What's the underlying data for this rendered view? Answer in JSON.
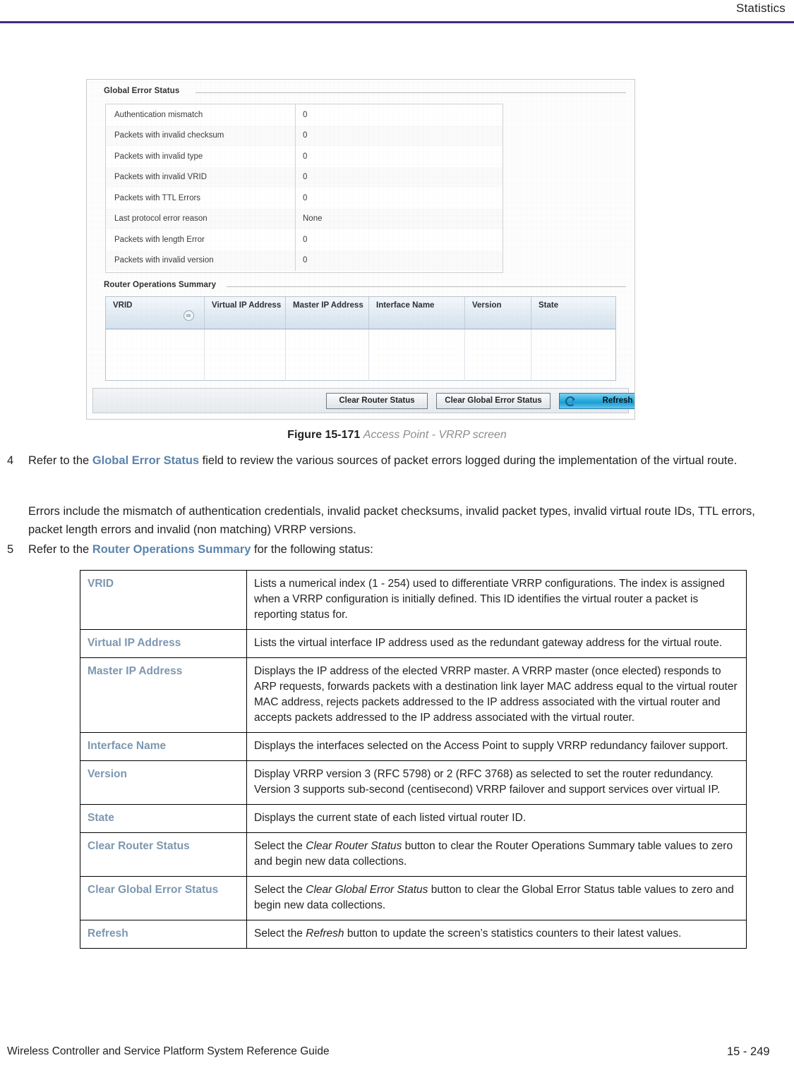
{
  "header": {
    "title": "Statistics"
  },
  "figure": {
    "number": "Figure 15-171",
    "label": "Access Point - VRRP screen",
    "screen": {
      "global_error_status": {
        "group_title": "Global Error Status",
        "rows": [
          {
            "label": "Authentication mismatch",
            "value": "0"
          },
          {
            "label": "Packets with invalid checksum",
            "value": "0"
          },
          {
            "label": "Packets with invalid type",
            "value": "0"
          },
          {
            "label": "Packets with invalid VRID",
            "value": "0"
          },
          {
            "label": "Packets with TTL Errors",
            "value": "0"
          },
          {
            "label": "Last protocol error reason",
            "value": "None"
          },
          {
            "label": "Packets with length Error",
            "value": "0"
          },
          {
            "label": "Packets with invalid version",
            "value": "0"
          }
        ]
      },
      "router_operations_summary": {
        "group_title": "Router Operations Summary",
        "columns": [
          "VRID",
          "Virtual IP Address",
          "Master IP Address",
          "Interface Name",
          "Version",
          "State"
        ],
        "rows": []
      },
      "buttons": {
        "clear_router_status": "Clear Router Status",
        "clear_global_error_status": "Clear Global Error Status",
        "refresh": "Refresh"
      }
    }
  },
  "steps": [
    {
      "num": "4",
      "lead": "Refer to the ",
      "emphasis": "Global Error Status",
      "rest": " field to review the various sources of packet errors logged during the implementation of the virtual route."
    },
    {
      "num": "",
      "text": "Errors include the mismatch of authentication credentials, invalid packet checksums, invalid packet types, invalid virtual route IDs, TTL errors, packet length errors and invalid (non matching) VRRP versions."
    },
    {
      "num": "5",
      "lead": "Refer to the ",
      "emphasis": "Router Operations Summary",
      "rest": " for the following status:"
    }
  ],
  "definitions": [
    {
      "term": "VRID",
      "desc": "Lists a numerical index (1 - 254) used to differentiate VRRP configurations. The index is assigned when a VRRP configuration is initially defined. This ID identifies the virtual router a packet is reporting status for."
    },
    {
      "term": "Virtual IP Address",
      "desc": "Lists the virtual interface IP address used as the redundant gateway address for the virtual route."
    },
    {
      "term": "Master IP Address",
      "desc": "Displays the IP address of the elected VRRP master. A VRRP master (once elected) responds to ARP requests, forwards packets with a destination link layer MAC address equal to the virtual router MAC address, rejects packets addressed to the IP address associated with the virtual router and accepts packets addressed to the IP address associated with the virtual router."
    },
    {
      "term": "Interface Name",
      "desc": "Displays the interfaces selected on the Access Point to supply VRRP redundancy failover support."
    },
    {
      "term": "Version",
      "desc": "Display VRRP version 3 (RFC 5798) or 2 (RFC 3768) as selected to set the router redundancy. Version 3 supports sub-second (centisecond) VRRP failover and support services over virtual IP."
    },
    {
      "term": "State",
      "desc": "Displays the current state of each listed virtual router ID."
    },
    {
      "term": "Clear Router Status",
      "desc_pre": "Select the ",
      "desc_em": "Clear Router Status",
      "desc_post": " button to clear the Router Operations Summary table values to zero and begin new data collections."
    },
    {
      "term": "Clear Global Error Status",
      "desc_pre": "Select the ",
      "desc_em": "Clear Global Error Status",
      "desc_post": " button to clear the Global Error Status table values to zero and begin new data collections."
    },
    {
      "term": "Refresh",
      "desc_pre": "Select the ",
      "desc_em": "Refresh",
      "desc_post": " button to update the screen’s statistics counters to their latest values."
    }
  ],
  "footer": {
    "guide": "Wireless Controller and Service Platform System Reference Guide",
    "page": "15 - 249"
  },
  "colors": {
    "rule_purple": "#4a2583",
    "term_blue": "#7d97b1",
    "emphasis_blue": "#5b84ad"
  }
}
